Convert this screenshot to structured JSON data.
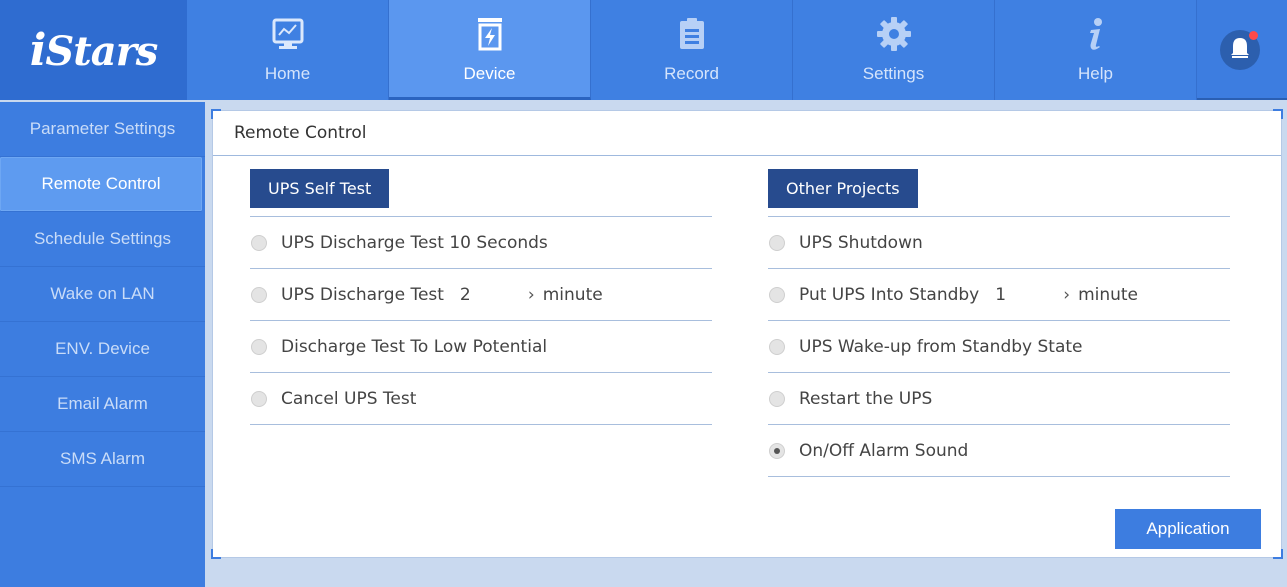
{
  "logo": {
    "text_i": "i",
    "text_rest": "Stars"
  },
  "nav": {
    "items": [
      {
        "label": "Home",
        "icon": "monitor-chart-icon"
      },
      {
        "label": "Device",
        "icon": "battery-bolt-icon"
      },
      {
        "label": "Record",
        "icon": "clipboard-icon"
      },
      {
        "label": "Settings",
        "icon": "gear-icon"
      },
      {
        "label": "Help",
        "icon": "info-icon"
      }
    ],
    "active": "Device"
  },
  "notification": {
    "icon": "bell-icon",
    "badge_color": "#ff4a4a"
  },
  "sidebar": {
    "items": [
      {
        "label": "Parameter Settings"
      },
      {
        "label": "Remote Control"
      },
      {
        "label": "Schedule Settings"
      },
      {
        "label": "Wake on LAN"
      },
      {
        "label": "ENV. Device"
      },
      {
        "label": "Email Alarm"
      },
      {
        "label": "SMS Alarm"
      }
    ],
    "active": "Remote Control"
  },
  "panel": {
    "title": "Remote Control",
    "self_test": {
      "header": "UPS Self Test",
      "options": [
        {
          "label": "UPS Discharge Test 10 Seconds",
          "checked": false
        },
        {
          "label": "UPS Discharge Test",
          "value": "2",
          "unit": "minute",
          "checked": false
        },
        {
          "label": "Discharge Test To Low Potential",
          "checked": false
        },
        {
          "label": "Cancel UPS Test",
          "checked": false
        }
      ]
    },
    "other": {
      "header": "Other Projects",
      "options": [
        {
          "label": "UPS Shutdown",
          "checked": false
        },
        {
          "label": "Put UPS Into Standby",
          "value": "1",
          "unit": "minute",
          "checked": false
        },
        {
          "label": "UPS Wake-up from Standby State",
          "checked": false
        },
        {
          "label": "Restart the UPS",
          "checked": false
        },
        {
          "label": "On/Off Alarm Sound",
          "checked": true
        }
      ]
    },
    "apply_label": "Application"
  },
  "colors": {
    "accent": "#3d7de0",
    "header_dark": "#274b8e",
    "active_tab": "#5b97ef"
  }
}
